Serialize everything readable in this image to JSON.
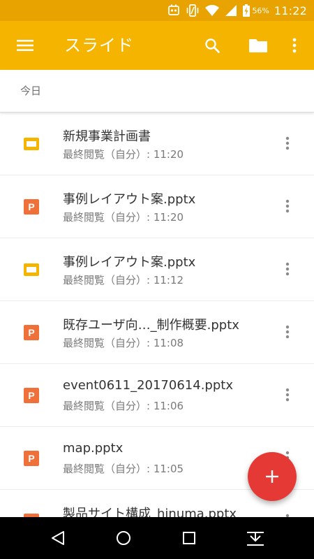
{
  "status_bar": {
    "battery_percent": "56%",
    "time": "11:22",
    "icons": [
      "notification-icon",
      "vibrate-icon",
      "wifi-icon",
      "signal-icon",
      "battery-charging-icon"
    ]
  },
  "app_bar": {
    "title": "スライド",
    "icons": [
      "menu-icon",
      "search-icon",
      "folder-icon",
      "more-vert-icon"
    ]
  },
  "section": {
    "label": "今日"
  },
  "files": [
    {
      "name": "新規事業計画書",
      "meta": "最終閲覧（自分）: 11:20",
      "type": "slides"
    },
    {
      "name": "事例レイアウト案.pptx",
      "meta": "最終閲覧（自分）: 11:20",
      "type": "pptx"
    },
    {
      "name": "事例レイアウト案.pptx",
      "meta": "最終閲覧（自分）: 11:12",
      "type": "slides"
    },
    {
      "name": "既存ユーザ向…_制作概要.pptx",
      "meta": "最終閲覧（自分）: 11:08",
      "type": "pptx"
    },
    {
      "name": "event0611_20170614.pptx",
      "meta": "最終閲覧（自分）: 11:06",
      "type": "pptx"
    },
    {
      "name": "map.pptx",
      "meta": "最終閲覧（自分）: 11:05",
      "type": "pptx"
    },
    {
      "name": "製品サイト構成_hinuma.pptx",
      "meta": "",
      "type": "pptx"
    }
  ],
  "colors": {
    "status_bar": "#e9a300",
    "app_bar": "#f4b400",
    "slides_icon": "#f4b400",
    "pptx_icon": "#f0703a",
    "fab": "#e53935"
  },
  "fab": {
    "icon": "plus-icon"
  },
  "nav_bar": {
    "icons": [
      "back-icon",
      "home-icon",
      "recents-icon",
      "hide-keyboard-icon"
    ]
  }
}
